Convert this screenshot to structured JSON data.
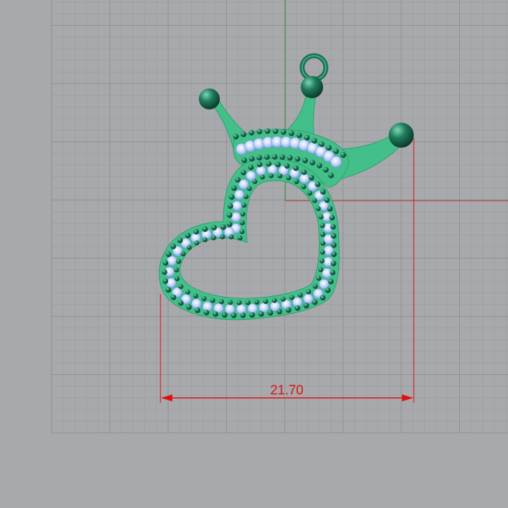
{
  "viewport": {
    "background": "#a7a9ac",
    "grid_minor_color": "#9c9ea2",
    "grid_major_color": "#8e9094",
    "y_axis_color": "#3f9a3f",
    "x_axis_color": "#c0392b"
  },
  "model": {
    "body_color": "#43c08a",
    "prong_color": "#1b7a5a",
    "stone_color": "#bcd2ff",
    "bead_color": "#1e6b52"
  },
  "dimension": {
    "value": "21.70",
    "color": "#e01010"
  }
}
